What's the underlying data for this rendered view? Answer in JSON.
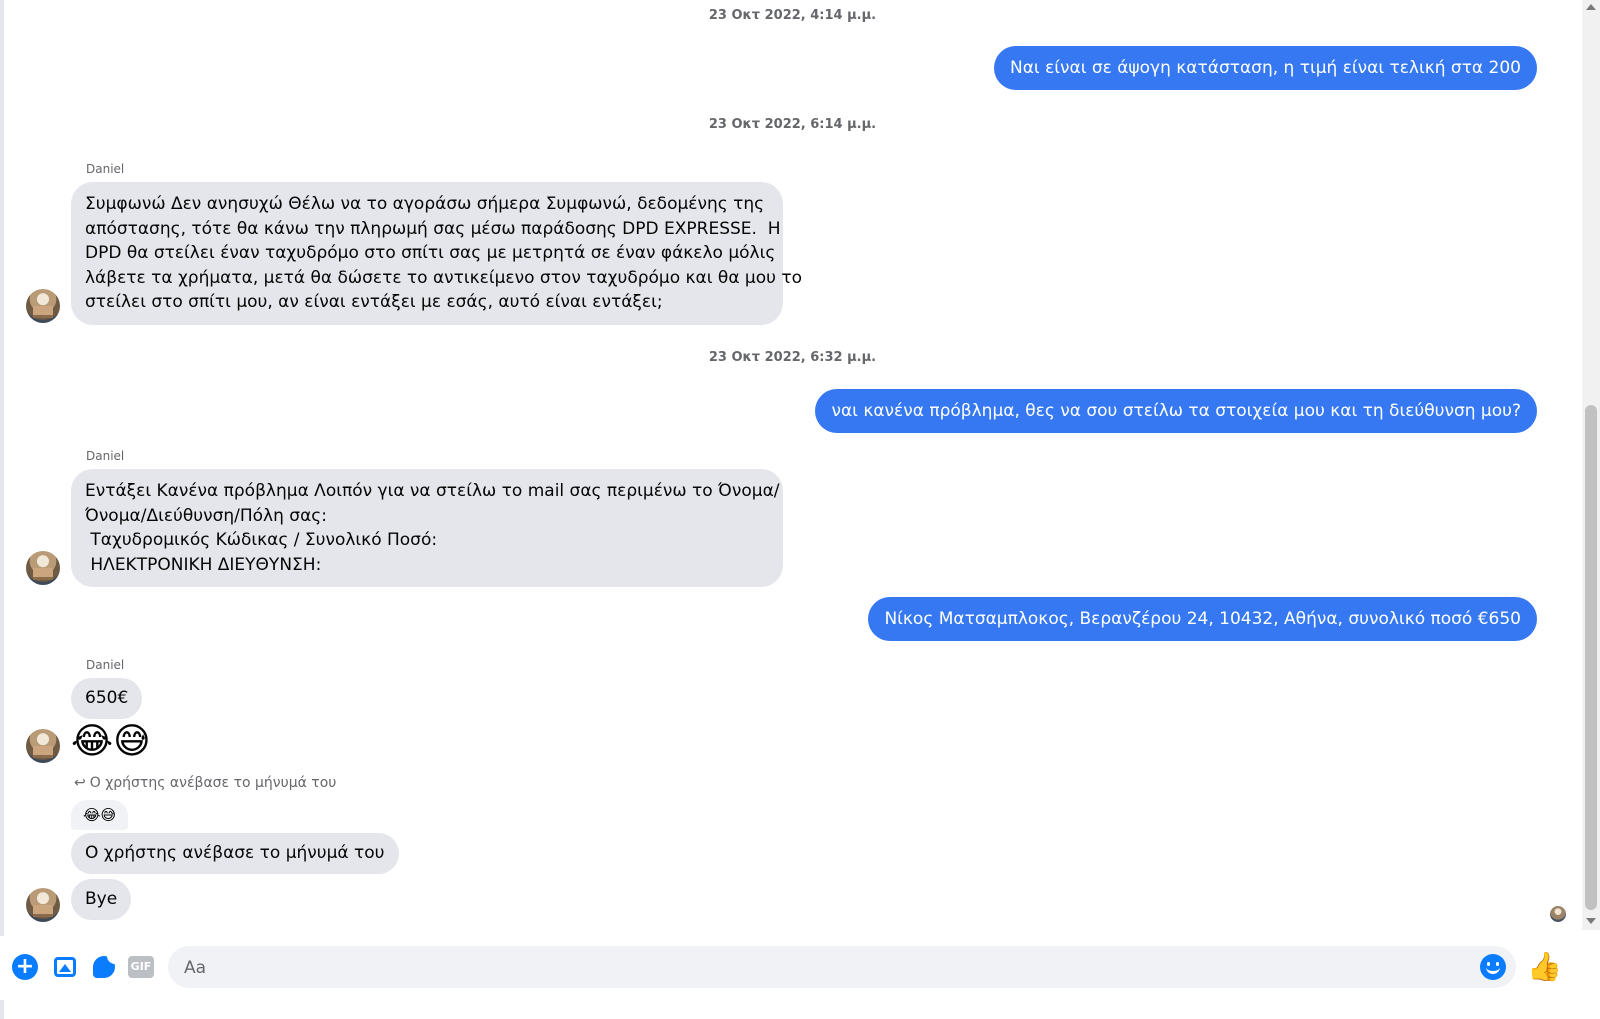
{
  "conversation": {
    "timestamps": [
      "23 Οκτ 2022, 4:14 μ.μ.",
      "23 Οκτ 2022, 6:14 μ.μ.",
      "23 Οκτ 2022, 6:32 μ.μ."
    ],
    "sender_name": "Daniel",
    "out_messages": [
      "Ναι είναι σε άψογη κατάσταση, η τιμή είναι τελική στα 200",
      "ναι κανένα πρόβλημα, θες να σου στείλω τα στοιχεία μου και τη διεύθυνση μου?",
      "Νίκος Ματσαμπλοκος, Βερανζέρου 24, 10432, Αθήνα, συνολικό ποσό €650"
    ],
    "in_message_1_lines": [
      "Συμφωνώ Δεν ανησυχώ Θέλω να το αγοράσω σήμερα Συμφωνώ, δεδομένης της",
      "απόστασης, τότε θα κάνω την πληρωμή σας μέσω παράδοσης DPD EXPRESSE.  Η",
      "DPD θα στείλει έναν ταχυδρόμο στο σπίτι σας με μετρητά σε έναν φάκελο μόλις",
      "λάβετε τα χρήματα, μετά θα δώσετε το αντικείμενο στον ταχυδρόμο και θα μου το",
      "στείλει στο σπίτι μου, αν είναι εντάξει με εσάς, αυτό είναι εντάξει;"
    ],
    "in_message_2_lines": [
      "Εντάξει Κανένα πρόβλημα Λοιπόν για να στείλω το mail σας περιμένω το Όνομα/",
      "Όνομα/Διεύθυνση/Πόλη σας:",
      " Ταχυδρομικός Κώδικας / Συνολικό Ποσό:",
      " ΗΛΕΚΤΡΟΝΙΚΗ ΔΙΕΥΘΥΝΣΗ:"
    ],
    "in_amount": "650€",
    "in_emojis": "😂😅",
    "reply_note": "Ο χρήστης ανέβασε το μήνυμά του",
    "quoted_emojis": "😂😅",
    "in_reply_text": "Ο χρήστης  ανέβασε το μήνυμά του",
    "in_bye": "Bye"
  },
  "composer": {
    "placeholder": "Aa",
    "plus_icon": "+",
    "gif_label": "GIF",
    "like_icon": "👍",
    "accent_color": "#0a7cff"
  },
  "colors": {
    "outgoing_bubble": "#3578f2",
    "incoming_bubble": "#e4e6eb"
  }
}
